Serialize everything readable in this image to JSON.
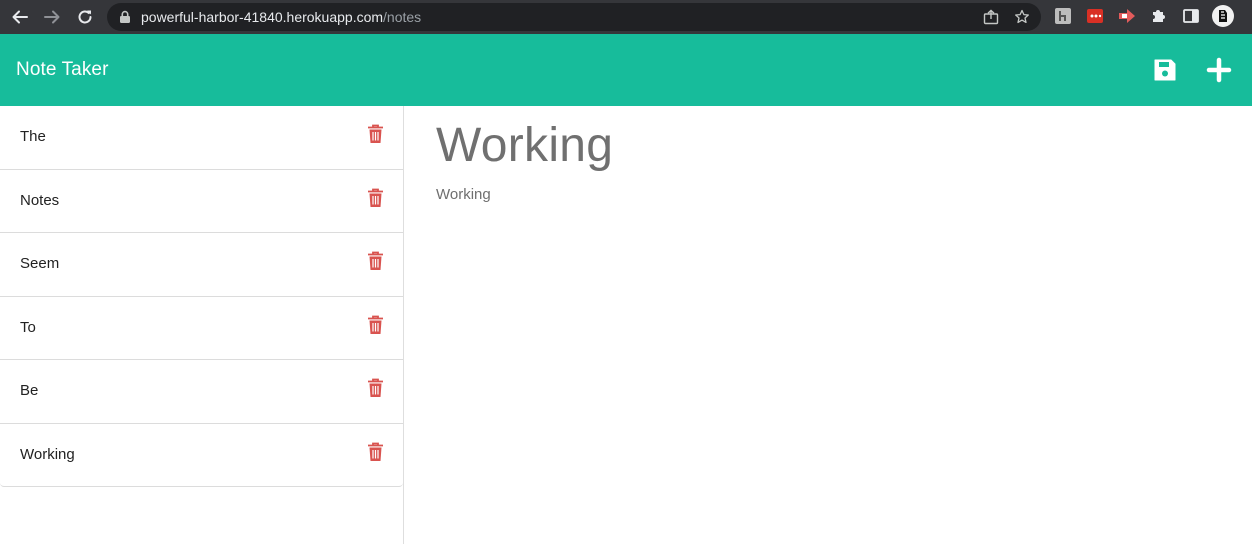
{
  "browser": {
    "url_domain": "powerful-harbor-41840.herokuapp.com",
    "url_path": "/notes"
  },
  "app": {
    "title": "Note Taker",
    "header_color": "#17bc9b",
    "icons": {
      "save": "save-icon",
      "add": "plus-icon",
      "delete": "trash-icon"
    }
  },
  "notes": [
    {
      "title": "The"
    },
    {
      "title": "Notes"
    },
    {
      "title": "Seem"
    },
    {
      "title": "To"
    },
    {
      "title": "Be"
    },
    {
      "title": "Working"
    }
  ],
  "active_note": {
    "title": "Working",
    "text": "Working"
  },
  "colors": {
    "delete_icon": "#d9534f",
    "text_muted": "#707070"
  }
}
